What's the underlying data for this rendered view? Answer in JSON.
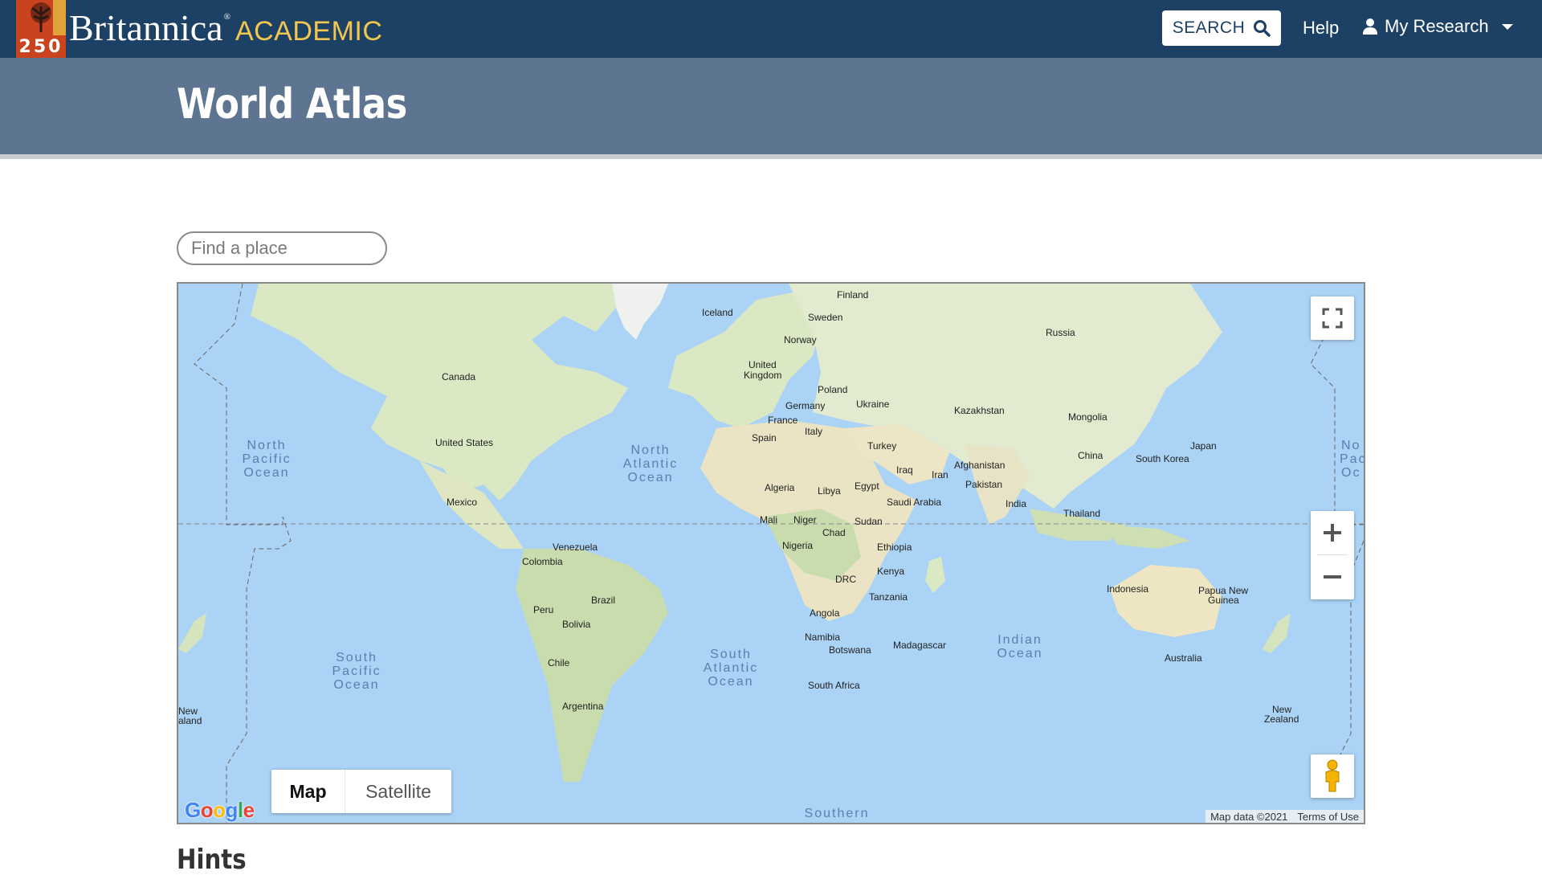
{
  "nav": {
    "logo_number": "250",
    "brand_name": "Britannica",
    "brand_reg": "®",
    "brand_suffix": "ACADEMIC",
    "search_label": "SEARCH",
    "help_label": "Help",
    "research_label": "My Research"
  },
  "page": {
    "title": "World Atlas",
    "hints_heading": "Hints"
  },
  "search": {
    "placeholder": "Find a place"
  },
  "map": {
    "map_type_options": [
      "Map",
      "Satellite"
    ],
    "selected_map_type": "Map",
    "attribution": "Map data ©2021",
    "terms_label": "Terms of Use",
    "google_logo": [
      "G",
      "o",
      "o",
      "g",
      "l",
      "e"
    ],
    "google_colors": [
      "#4285F4",
      "#EA4335",
      "#FBBC05",
      "#4285F4",
      "#34A853",
      "#EA4335"
    ],
    "country_labels": [
      {
        "id": "finland",
        "text": "Finland"
      },
      {
        "id": "iceland",
        "text": "Iceland"
      },
      {
        "id": "sweden",
        "text": "Sweden"
      },
      {
        "id": "norway",
        "text": "Norway"
      },
      {
        "id": "russia",
        "text": "Russia"
      },
      {
        "id": "uk1",
        "text": "United"
      },
      {
        "id": "uk2",
        "text": "Kingdom"
      },
      {
        "id": "canada",
        "text": "Canada"
      },
      {
        "id": "poland",
        "text": "Poland"
      },
      {
        "id": "germany",
        "text": "Germany"
      },
      {
        "id": "ukraine",
        "text": "Ukraine"
      },
      {
        "id": "kazakhstan",
        "text": "Kazakhstan"
      },
      {
        "id": "mongolia",
        "text": "Mongolia"
      },
      {
        "id": "france",
        "text": "France"
      },
      {
        "id": "italy",
        "text": "Italy"
      },
      {
        "id": "spain",
        "text": "Spain"
      },
      {
        "id": "usa",
        "text": "United States"
      },
      {
        "id": "turkey",
        "text": "Turkey"
      },
      {
        "id": "china",
        "text": "China"
      },
      {
        "id": "southkorea",
        "text": "South Korea"
      },
      {
        "id": "japan",
        "text": "Japan"
      },
      {
        "id": "afghanistan",
        "text": "Afghanistan"
      },
      {
        "id": "iraq",
        "text": "Iraq"
      },
      {
        "id": "iran",
        "text": "Iran"
      },
      {
        "id": "pakistan",
        "text": "Pakistan"
      },
      {
        "id": "algeria",
        "text": "Algeria"
      },
      {
        "id": "libya",
        "text": "Libya"
      },
      {
        "id": "egypt",
        "text": "Egypt"
      },
      {
        "id": "mexico",
        "text": "Mexico"
      },
      {
        "id": "saudi",
        "text": "Saudi Arabia"
      },
      {
        "id": "india",
        "text": "India"
      },
      {
        "id": "thailand",
        "text": "Thailand"
      },
      {
        "id": "mali",
        "text": "Mali"
      },
      {
        "id": "niger",
        "text": "Niger"
      },
      {
        "id": "sudan",
        "text": "Sudan"
      },
      {
        "id": "chad",
        "text": "Chad"
      },
      {
        "id": "nigeria",
        "text": "Nigeria"
      },
      {
        "id": "ethiopia",
        "text": "Ethiopia"
      },
      {
        "id": "venezuela",
        "text": "Venezuela"
      },
      {
        "id": "colombia",
        "text": "Colombia"
      },
      {
        "id": "kenya",
        "text": "Kenya"
      },
      {
        "id": "drc",
        "text": "DRC"
      },
      {
        "id": "indonesia",
        "text": "Indonesia"
      },
      {
        "id": "png1",
        "text": "Papua New"
      },
      {
        "id": "png2",
        "text": "Guinea"
      },
      {
        "id": "tanzania",
        "text": "Tanzania"
      },
      {
        "id": "brazil",
        "text": "Brazil"
      },
      {
        "id": "peru",
        "text": "Peru"
      },
      {
        "id": "bolivia",
        "text": "Bolivia"
      },
      {
        "id": "angola",
        "text": "Angola"
      },
      {
        "id": "namibia",
        "text": "Namibia"
      },
      {
        "id": "botswana",
        "text": "Botswana"
      },
      {
        "id": "madagascar",
        "text": "Madagascar"
      },
      {
        "id": "australia",
        "text": "Australia"
      },
      {
        "id": "chile",
        "text": "Chile"
      },
      {
        "id": "southafrica",
        "text": "South Africa"
      },
      {
        "id": "argentina",
        "text": "Argentina"
      },
      {
        "id": "nz_left1",
        "text": "New"
      },
      {
        "id": "nz_left2",
        "text": "aland"
      },
      {
        "id": "nz1",
        "text": "New"
      },
      {
        "id": "nz2",
        "text": "Zealand"
      }
    ],
    "ocean_labels": [
      {
        "id": "npo_l1",
        "text": "North"
      },
      {
        "id": "npo_l2",
        "text": "Pacific"
      },
      {
        "id": "npo_l3",
        "text": "Ocean"
      },
      {
        "id": "nao1",
        "text": "North"
      },
      {
        "id": "nao2",
        "text": "Atlantic"
      },
      {
        "id": "nao3",
        "text": "Ocean"
      },
      {
        "id": "spo1",
        "text": "South"
      },
      {
        "id": "spo2",
        "text": "Pacific"
      },
      {
        "id": "spo3",
        "text": "Ocean"
      },
      {
        "id": "sao1",
        "text": "South"
      },
      {
        "id": "sao2",
        "text": "Atlantic"
      },
      {
        "id": "sao3",
        "text": "Ocean"
      },
      {
        "id": "io1",
        "text": "Indian"
      },
      {
        "id": "io2",
        "text": "Ocean"
      },
      {
        "id": "npo_r1",
        "text": "No"
      },
      {
        "id": "npo_r2",
        "text": "Pac"
      },
      {
        "id": "npo_r3",
        "text": "Oc"
      },
      {
        "id": "southern",
        "text": "Southern"
      }
    ]
  }
}
